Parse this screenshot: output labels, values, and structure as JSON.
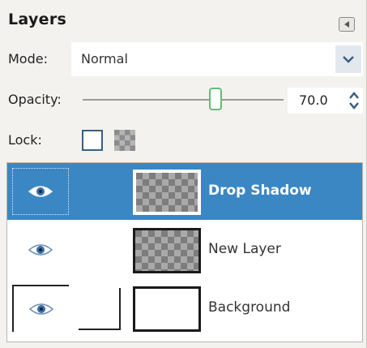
{
  "panel": {
    "title": "Layers"
  },
  "mode": {
    "label": "Mode:",
    "value": "Normal"
  },
  "opacity": {
    "label": "Opacity:",
    "value": "70.0",
    "level": 70.0
  },
  "lock": {
    "label": "Lock:"
  },
  "layers": [
    {
      "name": "Drop Shadow",
      "selected": true,
      "visible": true
    },
    {
      "name": "New Layer",
      "selected": false,
      "visible": true
    },
    {
      "name": "Background",
      "selected": false,
      "visible": true
    }
  ],
  "colors": {
    "selection": "#3a87c4",
    "slider_handle": "#5fbf7a",
    "panel_bg": "#f4f2ee"
  },
  "icons": {
    "collapse": "triangle-left-icon",
    "mode_dropdown": "chevron-down-icon",
    "spin": "up-down-arrows-icon",
    "visibility": "eye-icon"
  }
}
